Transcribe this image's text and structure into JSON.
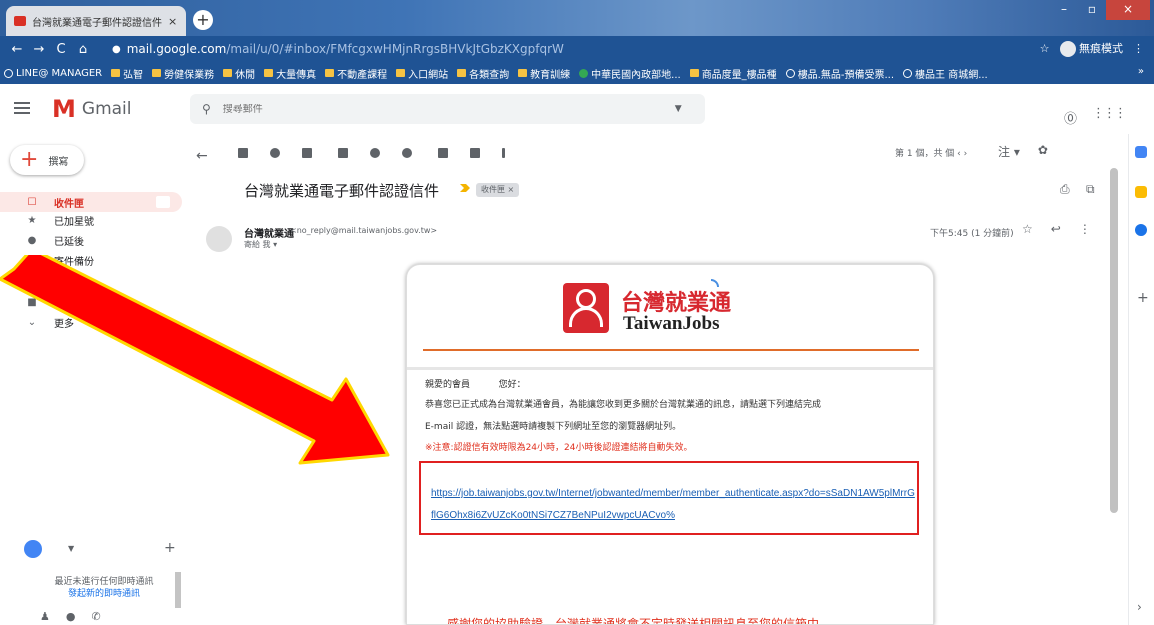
{
  "browser": {
    "tab_title": "台灣就業通電子郵件認證信件 - ",
    "tab_close": "×",
    "new_tab": "+",
    "nav": {
      "back": "←",
      "forward": "→",
      "reload": "C",
      "home": "⌂"
    },
    "url_host": "mail.google.com",
    "url_path": "/mail/u/0/#inbox/FMfcgxwHMjnRrgsBHVkJtGbzKXgpfqrW",
    "star": "☆",
    "profile_label": "無痕模式",
    "menu": "⋮",
    "bookmarks": [
      {
        "icon": "glob",
        "label": "LINE@ MANAGER"
      },
      {
        "icon": "folder",
        "label": "弘智"
      },
      {
        "icon": "folder",
        "label": "勞健保業務"
      },
      {
        "icon": "folder",
        "label": "休閒"
      },
      {
        "icon": "folder",
        "label": "大量傳真"
      },
      {
        "icon": "folder",
        "label": "不動產課程"
      },
      {
        "icon": "folder",
        "label": "入口網站"
      },
      {
        "icon": "folder",
        "label": "各類查詢"
      },
      {
        "icon": "folder",
        "label": "教育訓練"
      },
      {
        "icon": "green",
        "label": "中華民國內政部地..."
      },
      {
        "icon": "folder",
        "label": "商品度量_樓品種"
      },
      {
        "icon": "glob",
        "label": "樓品.無品-預備受票..."
      },
      {
        "icon": "glob",
        "label": "樓品王 商城網..."
      }
    ],
    "bookmarks_more": "»"
  },
  "gmail": {
    "product": "Gmail",
    "search_placeholder": "搜尋郵件",
    "compose_label": "撰寫",
    "nav": [
      {
        "icon": "inbox-icon",
        "glyph": "☐",
        "label": "收件匣"
      },
      {
        "icon": "star-icon",
        "glyph": "★",
        "label": "已加星號"
      },
      {
        "icon": "clock-icon",
        "glyph": "●",
        "label": "已延後"
      },
      {
        "icon": "send-icon",
        "glyph": "➤",
        "label": "寄件備份"
      },
      {
        "icon": "draft-icon",
        "glyph": "■",
        "label": "草稿"
      },
      {
        "icon": "label-icon",
        "glyph": "■",
        "label": "Notes"
      },
      {
        "icon": "chevron-down-icon",
        "glyph": "⌄",
        "label": "更多"
      }
    ],
    "hangouts_msg": "最近未進行任何即時通訊",
    "hangouts_link": "發起新的即時通訊",
    "page_info": "第 1 個，共    個   ‹   ›",
    "input_tool": "注 ▾",
    "settings": "✿"
  },
  "email": {
    "subject": "台灣就業通電子郵件認證信件",
    "label": "收件匣 ×",
    "sender_name": "台灣就業通",
    "sender_email": "<no_reply@mail.taiwanjobs.gov.tw>",
    "to": "寄給 我 ▾",
    "time": "下午5:45 (1 分鐘前)",
    "greeting": "親愛的會員          您好：",
    "para1": "恭喜您已正式成為台灣就業通會員，為能讓您收到更多關於台灣就業通的訊息，請點選下列連結完成",
    "para2": "E-mail 認證，無法點選時請複製下列網址至您的瀏覽器網址列。",
    "notice": "※注意:認證信有效時限為24小時，24小時後認證連結將自動失效。",
    "link": "https://job.taiwanjobs.gov.tw/Internet/jobwanted/member/member_authenticate.aspx?do=sSaDN1AW5plMrrGflG6Ohx8i6ZvUZcKo0tNSi7CZ7BeNPuI2vwpcUACvo%",
    "brand_zh": "台灣就業通",
    "brand_en": "TaiwanJobs",
    "bottom_text": "感謝您的協助驗證，台灣就業通將會不定時發送相關訊息至您的信箱中。"
  },
  "colors": {
    "gmail_red": "#d93025",
    "taiwanjobs_red": "#d7282f",
    "annotation_arrow_fill": "#ff0000",
    "annotation_arrow_stroke": "#ffd800",
    "link_box": "#e02020"
  }
}
